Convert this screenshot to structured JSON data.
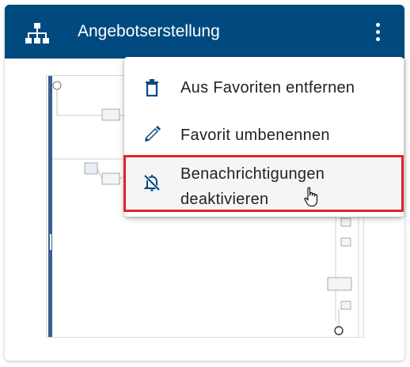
{
  "card": {
    "title": "Angebotserstellung",
    "header_icon": "sitemap-icon",
    "more_icon": "more-vertical-icon",
    "header_color": "#004a80"
  },
  "menu": {
    "items": [
      {
        "label": "Aus Favoriten entfernen",
        "icon": "trash-icon"
      },
      {
        "label": "Favorit umbenennen",
        "icon": "pencil-icon"
      },
      {
        "label": "Benachrichtigungen deaktivieren",
        "icon": "bell-off-icon",
        "highlighted": true
      }
    ],
    "highlight_color": "#e2232a"
  }
}
